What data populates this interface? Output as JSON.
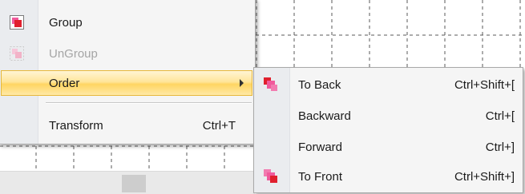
{
  "main_menu": {
    "items": [
      {
        "label": "Group",
        "shortcut": "",
        "icon": "group-icon",
        "disabled": false
      },
      {
        "label": "UnGroup",
        "shortcut": "",
        "icon": "ungroup-icon",
        "disabled": true
      },
      {
        "label": "Order",
        "shortcut": "",
        "icon": "",
        "disabled": false,
        "highlighted": true,
        "has_submenu": true
      },
      {
        "label": "Transform",
        "shortcut": "Ctrl+T",
        "icon": "",
        "disabled": false
      }
    ]
  },
  "order_submenu": {
    "items": [
      {
        "label": "To Back",
        "shortcut": "Ctrl+Shift+[",
        "icon": "to-back-icon"
      },
      {
        "label": "Backward",
        "shortcut": "Ctrl+[",
        "icon": ""
      },
      {
        "label": "Forward",
        "shortcut": "Ctrl+]",
        "icon": ""
      },
      {
        "label": "To Front",
        "shortcut": "Ctrl+Shift+]",
        "icon": "to-front-icon"
      }
    ]
  },
  "colors": {
    "highlight": "#ffd562",
    "highlight_border": "#e6b739",
    "icon_red": "#e0202e",
    "icon_pink": "#f05a9c",
    "icon_disabled": "#f2b3c8"
  }
}
